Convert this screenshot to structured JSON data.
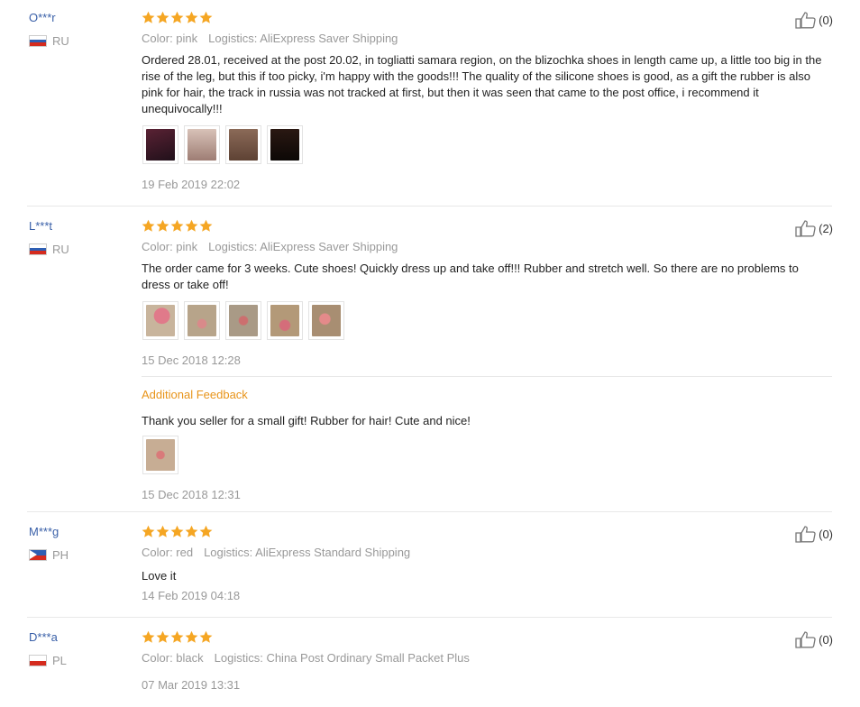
{
  "reviews": [
    {
      "user": "O***r",
      "country": "RU",
      "rating": 5,
      "color": "Color: pink",
      "logistics": "Logistics: AliExpress Saver Shipping",
      "text": "Ordered 28.01, received at the post 20.02, in togliatti samara region, on the blizochka shoes in length came up, a little too big in the rise of the leg, but this if too picky, i'm happy with the goods!!! The quality of the silicone shoes is good, as a gift the rubber is also pink for hair, the track in russia was not tracked at first, but then it was seen that came to the post office, i recommend it unequivocally!!!",
      "date": "19 Feb 2019 22:02",
      "likes": "(0)",
      "photos": [
        "#3b1a22",
        "#c9a6a0",
        "#7d5a4a",
        "#1c1410"
      ]
    },
    {
      "user": "L***t",
      "country": "RU",
      "rating": 5,
      "color": "Color: pink",
      "logistics": "Logistics: AliExpress Saver Shipping",
      "text": "The order came for 3 weeks. Cute shoes! Quickly dress up and take off!!! Rubber and stretch well. So there are no problems to dress or take off!",
      "date": "15 Dec 2018 12:28",
      "likes": "(2)",
      "photos": [
        "#c8b49c",
        "#b7a48a",
        "#a99a86",
        "#b39978",
        "#a88e72"
      ],
      "additional": {
        "label": "Additional Feedback",
        "text": "Thank you seller for a small gift! Rubber for hair! Cute and nice!",
        "date": "15 Dec 2018 12:31",
        "photos": [
          "#c7ad94"
        ]
      }
    },
    {
      "user": "M***g",
      "country": "PH",
      "rating": 5,
      "color": "Color: red",
      "logistics": "Logistics: AliExpress Standard Shipping",
      "text": "Love it",
      "date": "14 Feb 2019 04:18",
      "likes": "(0)"
    },
    {
      "user": "D***a",
      "country": "PL",
      "rating": 5,
      "color": "Color: black",
      "logistics": "Logistics: China Post Ordinary Small Packet Plus",
      "date": "07 Mar 2019 13:31",
      "likes": "(0)"
    }
  ],
  "colors": {
    "star": "#f5a623",
    "username": "#3a60a8",
    "additional": "#e8941a",
    "muted": "#999999"
  },
  "icons": {
    "star": "star-icon",
    "like": "thumbs-up-icon",
    "flag": "country-flag-icon"
  }
}
